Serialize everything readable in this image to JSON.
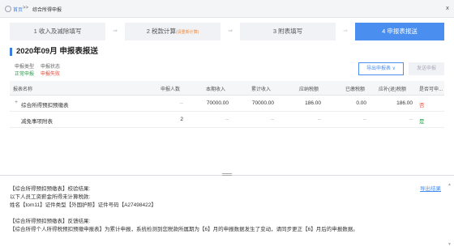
{
  "breadcrumb": {
    "home": "首页",
    "separator": ">>",
    "current": "综合所得申报"
  },
  "window": {
    "close": "ⅹ"
  },
  "steps": [
    {
      "label": "1 收入及减除填写",
      "note": ""
    },
    {
      "label": "2 税款计算",
      "note": "(请重新计算)"
    },
    {
      "label": "3 附表填写",
      "note": ""
    },
    {
      "label": "4 申报表报送",
      "note": ""
    }
  ],
  "arrows": "⇒",
  "period_title": "2020年09月 申报表报送",
  "meta": {
    "type_label": "申报类型",
    "type_value": "正常申报",
    "status_label": "申报状态",
    "status_value": "申报失败"
  },
  "buttons": {
    "export": "导出申报表 ∨",
    "submit": "发送申报"
  },
  "table": {
    "headers": [
      "报表名称",
      "申报人数",
      "本期收入",
      "累计收入",
      "应纳税额",
      "已缴税额",
      "应补(退)税额",
      "是否可申..."
    ],
    "rows": [
      {
        "expand": "+",
        "name": "综合所得预扣预缴表",
        "count": "--",
        "income": "70000.00",
        "cum_income": "70000.00",
        "tax": "186.00",
        "paid": "0.00",
        "due": "186.00",
        "flag": "否"
      },
      {
        "expand": "",
        "name": "减免事项附表",
        "count": "2",
        "income": "--",
        "cum_income": "--",
        "tax": "--",
        "paid": "--",
        "due": "--",
        "flag": "是"
      }
    ]
  },
  "results": {
    "export_link": "导出结果",
    "lines": [
      "【综合所得预扣预缴表】校验结果:",
      "以下人员工资薪金所得未计算税款:",
      "姓名【tom11】证件类型【外国护照】证件号码【A27498422】",
      "",
      "【综合所得预扣预缴表】反馈结果:",
      "【综合所得个人所得税预扣预缴申报表】为累计申报，系统检测到您税款所属期为【6】月的申报数据发生了变动，请同步更正【6】月后的申报数据。"
    ]
  },
  "colors": {
    "accent": "#4a8ef0",
    "success": "#2a9d4a",
    "danger": "#e24b3b"
  }
}
